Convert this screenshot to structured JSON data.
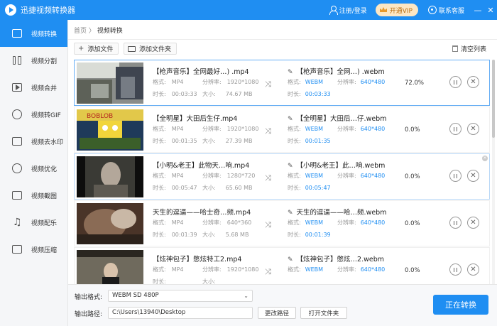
{
  "app": {
    "title": "迅捷视频转换器"
  },
  "header": {
    "login": "注册/登录",
    "vip": "开通VIP",
    "service": "联系客服",
    "minimize": "—",
    "close": "✕"
  },
  "sidebar": {
    "items": [
      {
        "label": "视频转换",
        "icon": "video-convert-icon"
      },
      {
        "label": "视频分割",
        "icon": "video-split-icon"
      },
      {
        "label": "视频合并",
        "icon": "video-merge-icon"
      },
      {
        "label": "视频转GIF",
        "icon": "gif-icon"
      },
      {
        "label": "视频去水印",
        "icon": "watermark-remove-icon"
      },
      {
        "label": "视频优化",
        "icon": "video-optimize-icon"
      },
      {
        "label": "视频截图",
        "icon": "screenshot-icon"
      },
      {
        "label": "视频配乐",
        "icon": "music-icon"
      },
      {
        "label": "视频压缩",
        "icon": "compress-icon"
      }
    ]
  },
  "breadcrumb": {
    "home": "首页",
    "sep": "〉",
    "current": "视频转换"
  },
  "toolbar": {
    "add_file": "添加文件",
    "add_folder": "添加文件夹",
    "clear_list": "清空列表"
  },
  "labels": {
    "format": "格式:",
    "resolution": "分辨率:",
    "duration": "时长:",
    "size": "大小:"
  },
  "files": [
    {
      "src_name": "【枪声音乐】全网最好…) .mp4",
      "format": "MP4",
      "resolution": "1920*1080",
      "duration": "00:03:33",
      "size": "74.67 MB",
      "out_name": "【枪声音乐】全网…) .webm",
      "out_format": "WEBM",
      "out_resolution": "640*480",
      "out_duration": "00:03:33",
      "progress": "72.0%"
    },
    {
      "src_name": "【全明星】大田后生仔.mp4",
      "format": "MP4",
      "resolution": "1920*1080",
      "duration": "00:01:35",
      "size": "27.39 MB",
      "out_name": "【全明星】大田后…仔.webm",
      "out_format": "WEBM",
      "out_resolution": "640*480",
      "out_duration": "00:01:35",
      "progress": "0.0%"
    },
    {
      "src_name": "【小明&老王】此物天…响.mp4",
      "format": "MP4",
      "resolution": "1280*720",
      "duration": "00:05:47",
      "size": "65.60 MB",
      "out_name": "【小明&老王】此…响.webm",
      "out_format": "WEBM",
      "out_resolution": "640*480",
      "out_duration": "00:05:47",
      "progress": "0.0%"
    },
    {
      "src_name": "天生的逗逼——哈士奇…频.mp4",
      "format": "MP4",
      "resolution": "640*360",
      "duration": "00:01:39",
      "size": "5.68 MB",
      "out_name": "天生的逗逼——哈…频.webm",
      "out_format": "WEBM",
      "out_resolution": "640*480",
      "out_duration": "00:01:39",
      "progress": "0.0%"
    },
    {
      "src_name": "【炫神包子】憋炫特工2.mp4",
      "format": "MP4",
      "resolution": "1920*1080",
      "duration": "",
      "size": "",
      "out_name": "【炫神包子】憋炫…2.webm",
      "out_format": "WEBM",
      "out_resolution": "640*480",
      "out_duration": "",
      "progress": "0.0%"
    }
  ],
  "bottom": {
    "format_label": "输出格式:",
    "format_value": "WEBM  SD 480P",
    "path_label": "输出路径:",
    "path_value": "C:\\Users\\13940\\Desktop",
    "change_path": "更改路径",
    "open_folder": "打开文件夹",
    "start": "正在转换"
  },
  "colors": {
    "accent": "#1f8ef2",
    "vip_bg": "#fde7c4",
    "vip_text": "#b86f14"
  }
}
